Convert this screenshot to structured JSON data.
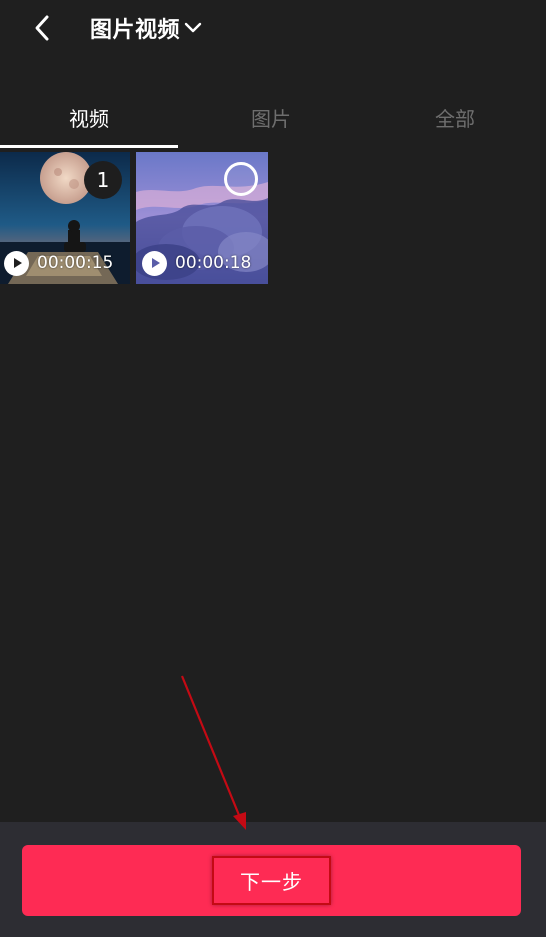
{
  "header": {
    "back_icon": "back-chevron-icon",
    "title": "图片视频",
    "title_dropdown_icon": "chevron-down-icon"
  },
  "tabs": [
    {
      "label": "视频",
      "active": true
    },
    {
      "label": "图片",
      "active": false
    },
    {
      "label": "全部",
      "active": false
    }
  ],
  "media": [
    {
      "type": "video",
      "duration": "00:00:15",
      "selected": true,
      "selection_index": "1"
    },
    {
      "type": "video",
      "duration": "00:00:18",
      "selected": false,
      "selection_index": ""
    }
  ],
  "footer": {
    "next_label": "下一步"
  },
  "colors": {
    "background": "#1f1f1f",
    "accent": "#fe2b54",
    "bottom_bar": "#2d2d33",
    "tab_inactive": "#6e6e6e",
    "annotation": "#c40a14"
  }
}
